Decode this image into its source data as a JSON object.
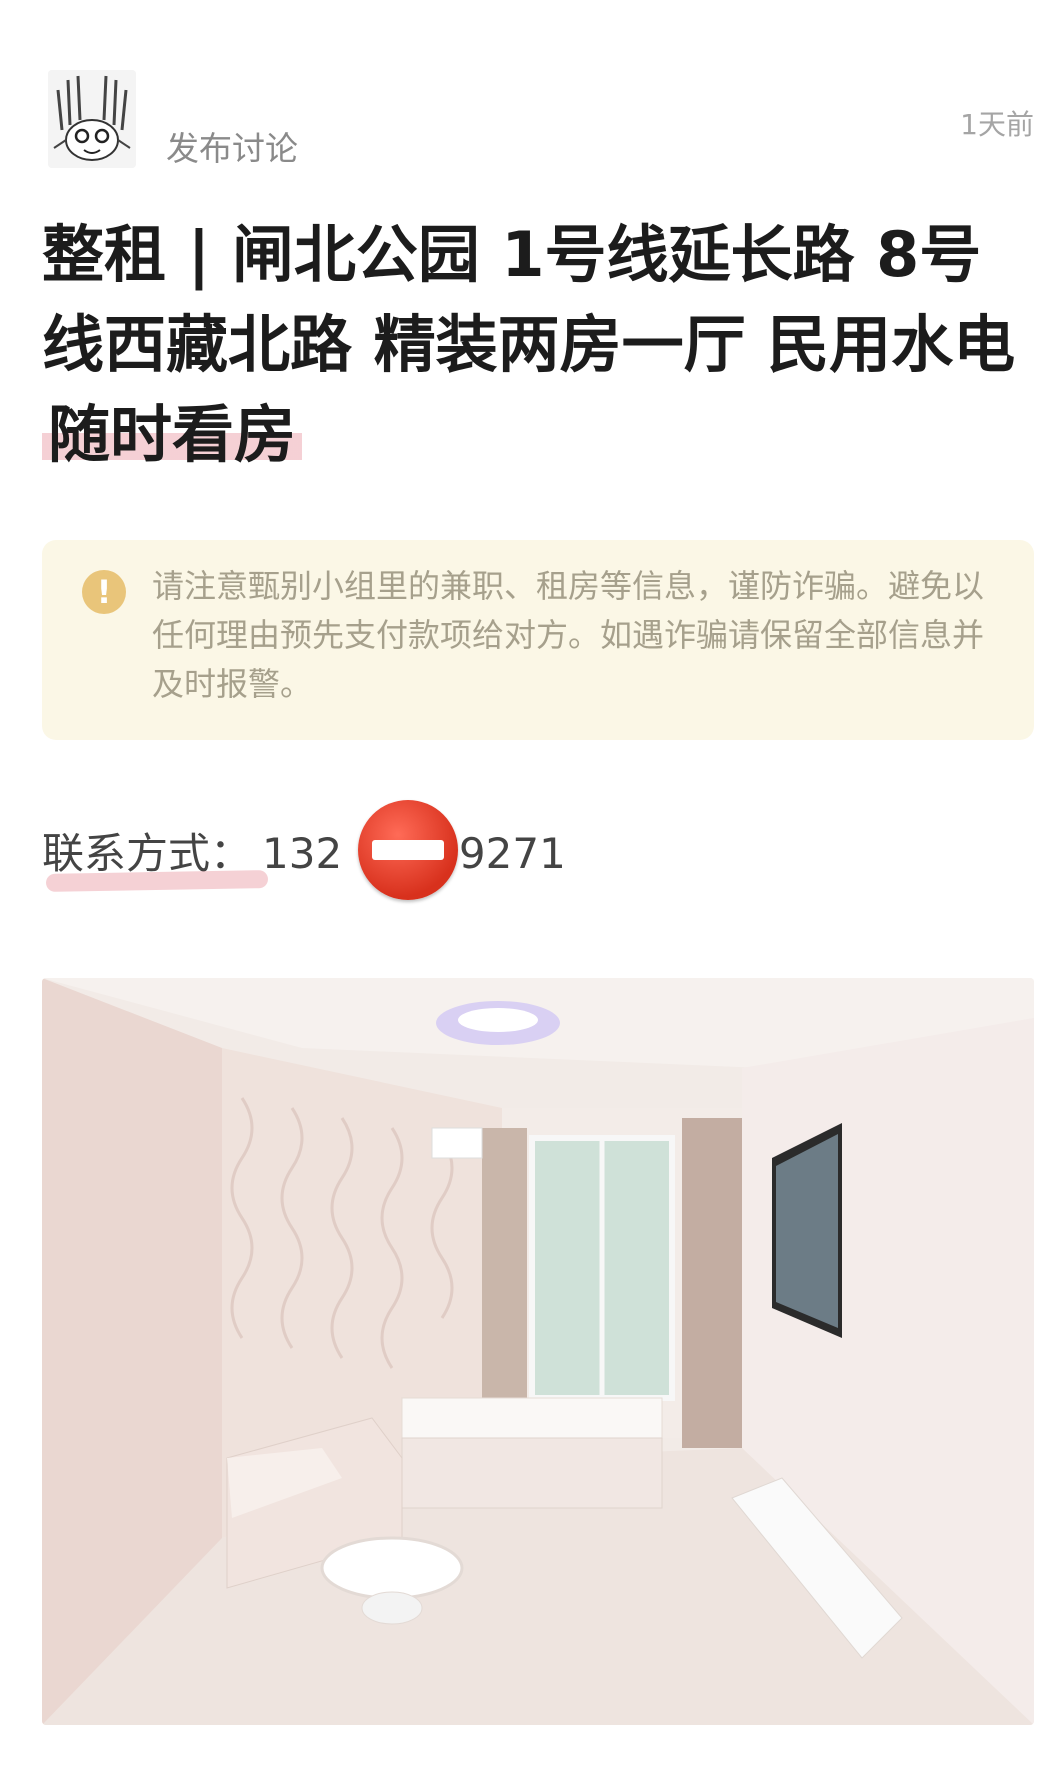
{
  "header": {
    "author_action": "发布讨论",
    "time": "1天前",
    "avatar_icon": "sketch-avatar-icon"
  },
  "title": {
    "main": "整租 | 闸北公园 1号线延长路 8号线西藏北路 精装两房一厅 民用水电 ",
    "highlight": "随时看房"
  },
  "notice": {
    "icon": "warning-exclamation-icon",
    "text": "请注意甄别小组里的兼职、租房等信息，谨防诈骗。避免以任何理由预先支付款项给对方。如遇诈骗请保留全部信息并及时报警。"
  },
  "contact": {
    "label": "联系方式：",
    "phone_prefix": "132",
    "phone_suffix": "39271",
    "redaction_icon": "no-entry-emoji-icon"
  },
  "photo": {
    "description_icon": "room-photo-icon"
  },
  "colors": {
    "highlight": "#e998a2",
    "notice_bg": "#fbf7e6",
    "notice_text": "#a6a08c",
    "warning": "#e9c57a"
  }
}
